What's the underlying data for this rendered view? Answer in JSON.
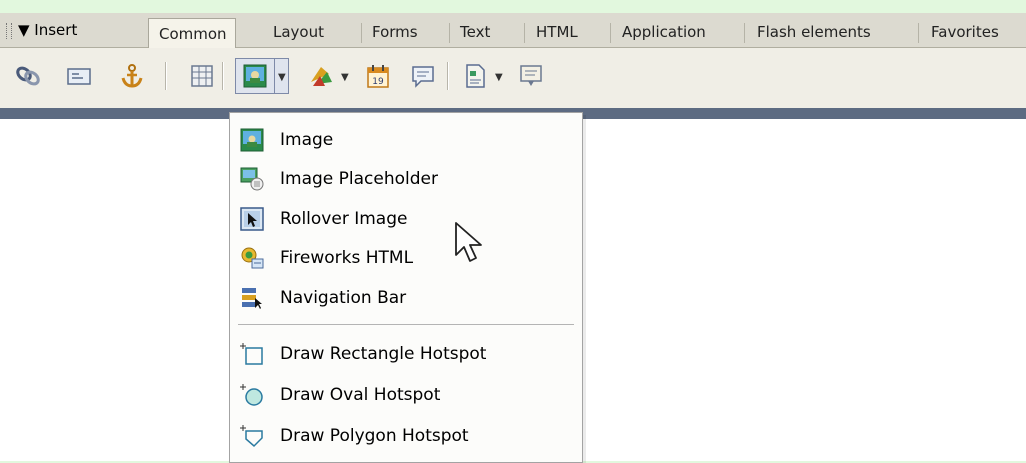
{
  "insert_bar": {
    "title": "▼ Insert",
    "tabs": [
      "Common",
      "Layout",
      "Forms",
      "Text",
      "HTML",
      "Application",
      "Flash elements",
      "Favorites"
    ],
    "active_tab": "Common"
  },
  "toolbar": {
    "buttons": [
      "hyperlink-icon",
      "email-link-icon",
      "named-anchor-icon",
      "table-icon",
      "image-icon",
      "media-icon",
      "date-icon",
      "comment-icon",
      "template-icon",
      "tag-chooser-icon"
    ]
  },
  "image_menu": {
    "items": [
      {
        "label": "Image",
        "icon": "image-icon"
      },
      {
        "label": "Image Placeholder",
        "icon": "image-placeholder-icon"
      },
      {
        "label": "Rollover Image",
        "icon": "rollover-image-icon"
      },
      {
        "label": "Fireworks HTML",
        "icon": "fireworks-html-icon"
      },
      {
        "label": "Navigation Bar",
        "icon": "navigation-bar-icon"
      }
    ],
    "hotspot_items": [
      {
        "label": "Draw Rectangle Hotspot",
        "icon": "rectangle-hotspot-icon"
      },
      {
        "label": "Draw Oval Hotspot",
        "icon": "oval-hotspot-icon"
      },
      {
        "label": "Draw Polygon Hotspot",
        "icon": "polygon-hotspot-icon"
      }
    ]
  },
  "colors": {
    "background": "#e2f8de",
    "band": "#5d6b82",
    "menu_bg": "#fcfcfa"
  }
}
